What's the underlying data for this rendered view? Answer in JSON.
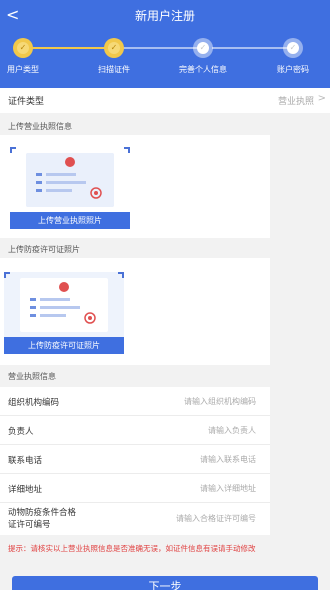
{
  "header": {
    "title": "新用户注册",
    "back_icon": "<"
  },
  "steps": [
    {
      "label": "用户类型",
      "state": "done"
    },
    {
      "label": "扫描证件",
      "state": "done"
    },
    {
      "label": "完善个人信息",
      "state": "todo"
    },
    {
      "label": "账户密码",
      "state": "todo"
    }
  ],
  "id_type": {
    "label": "证件类型",
    "value": "营业执照",
    "chevron": ">"
  },
  "license_upload": {
    "section_label": "上传营业执照信息",
    "button_label": "上传营业执照照片"
  },
  "permit_upload": {
    "section_label": "上传防疫许可证照片",
    "button_label": "上传防疫许可证照片"
  },
  "license_info": {
    "section_label": "营业执照信息",
    "fields": [
      {
        "label": "组织机构编码",
        "placeholder": "请输入组织机构编码"
      },
      {
        "label": "负责人",
        "placeholder": "请输入负责人"
      },
      {
        "label": "联系电话",
        "placeholder": "请输入联系电话"
      },
      {
        "label": "详细地址",
        "placeholder": "请输入详细地址"
      },
      {
        "label": "动物防疫条件合格证许可编号",
        "label_line1": "动物防疫条件合格",
        "label_line2": "证许可编号",
        "placeholder": "请输入合格证许可编号"
      }
    ]
  },
  "tip": "提示：请核实以上营业执照信息是否准确无误，如证件信息有误请手动修改",
  "next_button": "下一步",
  "colors": {
    "primary": "#3f6fe0",
    "step_done": "#f1c84b",
    "tip": "#e04040"
  }
}
